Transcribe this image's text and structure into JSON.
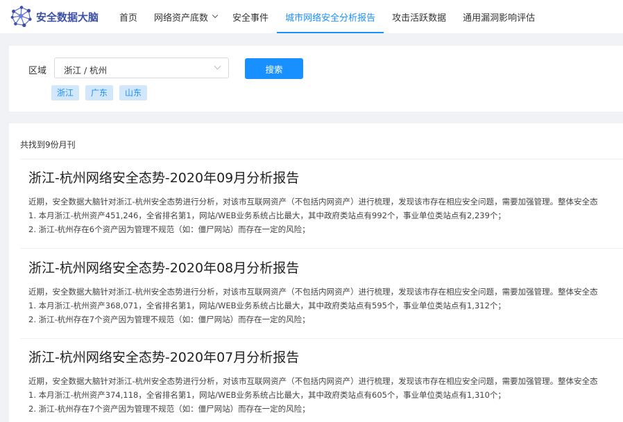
{
  "nav": {
    "logo_text": "安全数据大脑",
    "items": [
      {
        "label": "首页"
      },
      {
        "label": "网络资产底数"
      },
      {
        "label": "安全事件"
      },
      {
        "label": "城市网络安全分析报告"
      },
      {
        "label": "攻击活跃数据"
      },
      {
        "label": "通用漏洞影响评估"
      }
    ],
    "active_index": 3
  },
  "search": {
    "region_label": "区域",
    "region_value": "浙江 / 杭州",
    "search_button": "搜索",
    "tags": [
      "浙江",
      "广东",
      "山东"
    ]
  },
  "results": {
    "count_text": "共找到9份月刊",
    "reports": [
      {
        "title": "浙江-杭州网络安全态势-2020年09月分析报告",
        "lines": [
          "近期，安全数据大脑针对浙江-杭州安全态势进行分析，对该市互联网资产（不包括内网资产）进行梳理，发现该市存在相应安全问题，需要加强管理。整体安全态",
          "1. 本月浙江-杭州资产451,246，全省排名第1，网站/WEB业务系统占比最大，其中政府类站点有992个，事业单位类站点有2,239个；",
          "2. 浙江-杭州存在6个资产因为管理不规范（如：僵尸网站）而存在一定的风险；"
        ]
      },
      {
        "title": "浙江-杭州网络安全态势-2020年08月分析报告",
        "lines": [
          "近期，安全数据大脑针对浙江-杭州安全态势进行分析，对该市互联网资产（不包括内网资产）进行梳理，发现该市存在相应安全问题，需要加强管理。整体安全态",
          "1. 本月浙江-杭州资产368,071，全省排名第1，网站/WEB业务系统占比最大，其中政府类站点有595个，事业单位类站点有1,312个；",
          "2. 浙江-杭州存在7个资产因为管理不规范（如：僵尸网站）而存在一定的风险；"
        ]
      },
      {
        "title": "浙江-杭州网络安全态势-2020年07月分析报告",
        "lines": [
          "近期，安全数据大脑针对浙江-杭州安全态势进行分析，对该市互联网资产（不包括内网资产）进行梳理，发现该市存在相应安全问题，需要加强管理。整体安全态",
          "1. 本月浙江-杭州资产374,118，全省排名第1，网站/WEB业务系统占比最大，其中政府类站点有605个，事业单位类站点有1,310个；",
          "2. 浙江-杭州存在7个资产因为管理不规范（如：僵尸网站）而存在一定的风险；"
        ]
      }
    ]
  },
  "colors": {
    "accent": "#1890ff",
    "logo": "#3d51a8",
    "tag_bg": "#d3e7fb",
    "page_bg": "#f0f2f5"
  },
  "icons": {
    "logo": "network-graph-icon",
    "nav_dropdown": "chevron-down-icon",
    "select_dropdown": "chevron-down-icon"
  }
}
